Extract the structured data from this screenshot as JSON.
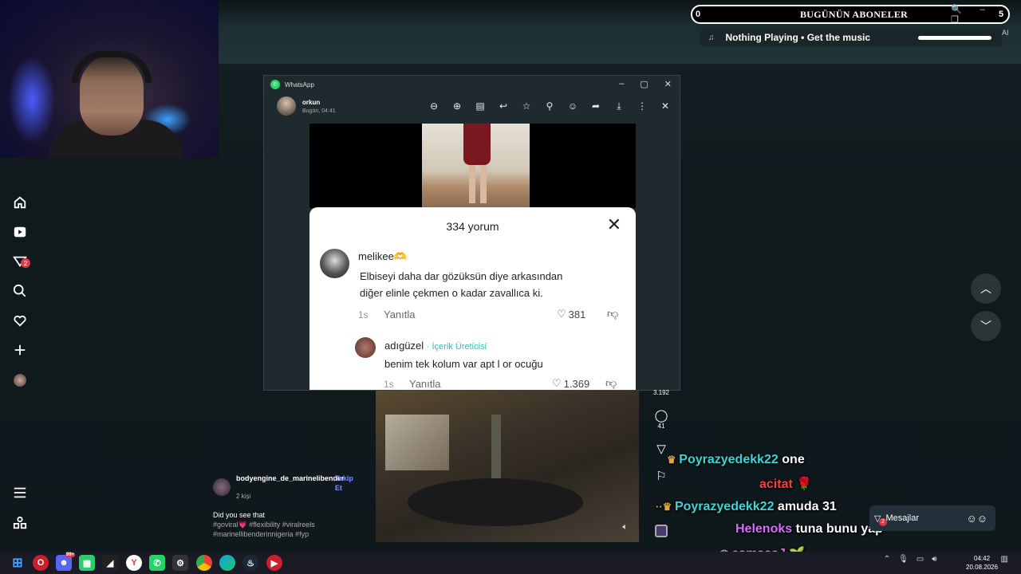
{
  "overlay": {
    "subs_count": "0",
    "subs_title": "BUGÜNÜN ABONELER",
    "subs_window_controls": "🔍 – ❐",
    "subs_right_count": "5",
    "music_note": "♫",
    "music_text": "Nothing Playing  •  Get the music",
    "ai_label": "AI"
  },
  "whatsapp": {
    "app_name": "WhatsApp",
    "contact_name": "orkun",
    "contact_time": "Bugün, 04:41",
    "tools": [
      "zoom-out-icon",
      "zoom-in-icon",
      "gallery-icon",
      "reply-icon",
      "star-icon",
      "pin-icon",
      "emoji-icon",
      "forward-icon",
      "download-icon",
      "more-icon",
      "close-icon"
    ]
  },
  "comments": {
    "header": "334 yorum",
    "items": [
      {
        "user": "melikee🫶",
        "text_line1": "Elbiseyi daha dar gözüksün diye arkasından",
        "text_line2": "diğer elinle çekmen o kadar zavallıca ki.",
        "time": "1s",
        "reply": "Yanıtla",
        "likes": "381"
      },
      {
        "user": "adıgüzel",
        "badge": "· İçerik Üreticisi",
        "text": "benim tek kolum var apt  l or      ocuğu",
        "time": "1s",
        "reply": "Yanıtla",
        "likes": "1.369"
      }
    ]
  },
  "feed": {
    "likes": "3.192",
    "comments": "41",
    "author": "bodyengine_de_marinelibender",
    "follow": "Takip Et",
    "followers": "2 kişi",
    "caption": "Did you see that",
    "tags": "#goviral💗 #flexibility #viralreels #marinellibenderinnigeria #fyp"
  },
  "chat": {
    "lines": [
      {
        "name": "Poyrazyedekk22",
        "msg": "one",
        "color": "#3ad6d8"
      },
      {
        "name": "acitat",
        "msg": "🌹",
        "color": "#ff3b3b"
      },
      {
        "name": "Poyrazyedekk22",
        "msg": "amuda 31",
        "color": "#3ad6d8"
      },
      {
        "name": "Helenoks",
        "msg": "tuna bunu yap",
        "color": "#d86cff"
      },
      {
        "name": "esmaaaJ",
        "msg": "🌱",
        "color": "#e46bd0"
      }
    ]
  },
  "messages_popup": {
    "label": "Mesajlar",
    "count": "2"
  },
  "taskbar": {
    "time": "04:42",
    "date": "20.08.2026",
    "app_count": "99+"
  }
}
